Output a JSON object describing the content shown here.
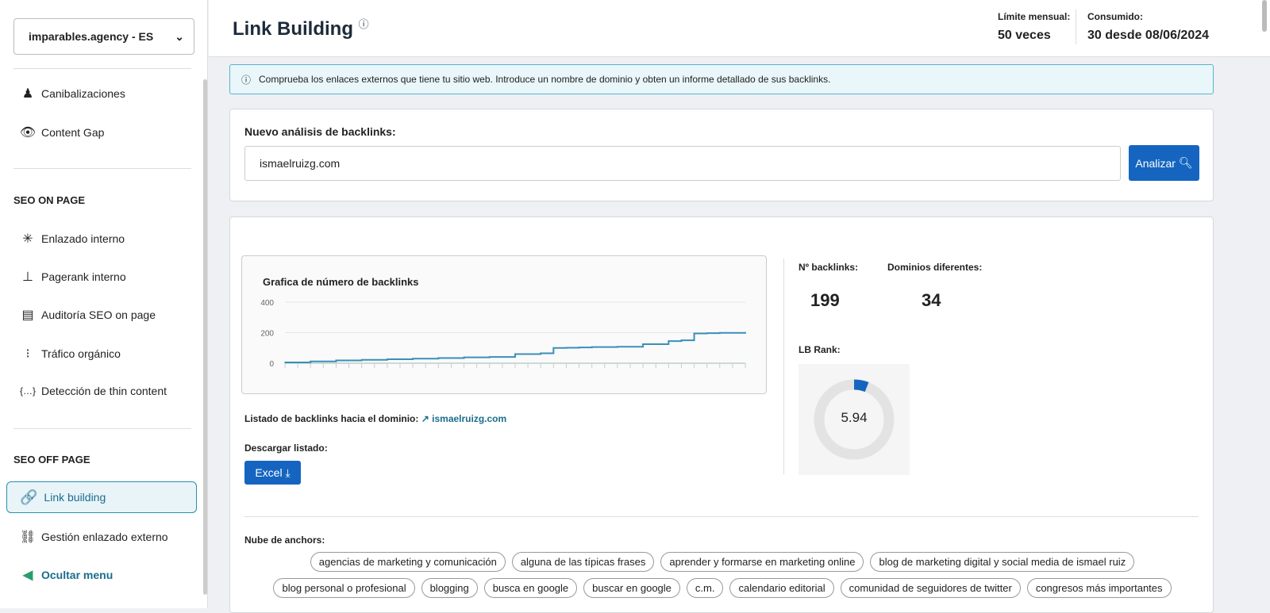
{
  "sidebar": {
    "project": "imparables.agency - ES",
    "items_top": [
      {
        "label": "Canibalizaciones",
        "icon": "cannibal-icon"
      },
      {
        "label": "Content Gap",
        "icon": "eye-icon"
      }
    ],
    "sec_on": "SEO ON PAGE",
    "items_on": [
      {
        "label": "Enlazado interno",
        "icon": "network-icon"
      },
      {
        "label": "Pagerank interno",
        "icon": "sitemap-icon"
      },
      {
        "label": "Auditoría SEO on page",
        "icon": "file-chart-icon"
      },
      {
        "label": "Tráfico orgánico",
        "icon": "traffic-light-icon"
      },
      {
        "label": "Detección de thin content",
        "icon": "braces-icon"
      }
    ],
    "sec_off": "SEO OFF PAGE",
    "active": "Link building",
    "items_off": [
      {
        "label": "Gestión enlazado externo",
        "icon": "links-icon"
      }
    ],
    "hide": "Ocultar menu"
  },
  "header": {
    "title": "Link Building",
    "limit_label": "Límite mensual:",
    "limit_value": "50 veces",
    "used_label": "Consumido:",
    "used_value": "30 desde 08/06/2024"
  },
  "info": "Comprueba los enlaces externos que tiene tu sitio web. Introduce un nombre de dominio y obten un informe detallado de sus backlinks.",
  "analysis": {
    "label": "Nuevo análisis de backlinks:",
    "value": "ismaelruizg.com",
    "button": "Analizar"
  },
  "results": {
    "list_label": "Listado de backlinks hacia el dominio:",
    "domain": "ismaelruizg.com",
    "download_label": "Descargar listado:",
    "excel": "Excel",
    "backlinks_label": "Nº backlinks:",
    "backlinks": "199",
    "domains_label": "Dominios diferentes:",
    "domains": "34",
    "rank_label": "LB Rank:",
    "rank": "5.94",
    "rank_fraction": 0.0594
  },
  "anchors": {
    "label": "Nube de anchors:",
    "tags": [
      "agencias de marketing y comunicación",
      "alguna de las típicas frases",
      "aprender y formarse en marketing online",
      "blog de marketing digital y social media de ismael ruiz",
      "blog personal o profesional",
      "blogging",
      "busca en google",
      "buscar en google",
      "c.m.",
      "calendario editorial",
      "comunidad de seguidores de twitter",
      "congresos más importantes"
    ]
  },
  "chart_data": {
    "type": "line",
    "title": "Grafica de número de backlinks",
    "xlabel": "",
    "ylabel": "",
    "ylim": [
      0,
      400
    ],
    "yticks": [
      "0",
      "200",
      "400"
    ],
    "x": [
      0,
      2,
      4,
      6,
      8,
      10,
      12,
      14,
      16,
      18,
      20,
      21,
      22,
      23,
      24,
      26,
      28,
      30,
      31,
      32,
      33,
      34,
      36
    ],
    "values": [
      5,
      12,
      18,
      22,
      26,
      30,
      34,
      38,
      41,
      60,
      65,
      100,
      101,
      103,
      106,
      108,
      125,
      145,
      150,
      195,
      197,
      199,
      201
    ]
  },
  "colors": {
    "accent": "#1565c0",
    "line": "#3a8fb8"
  }
}
